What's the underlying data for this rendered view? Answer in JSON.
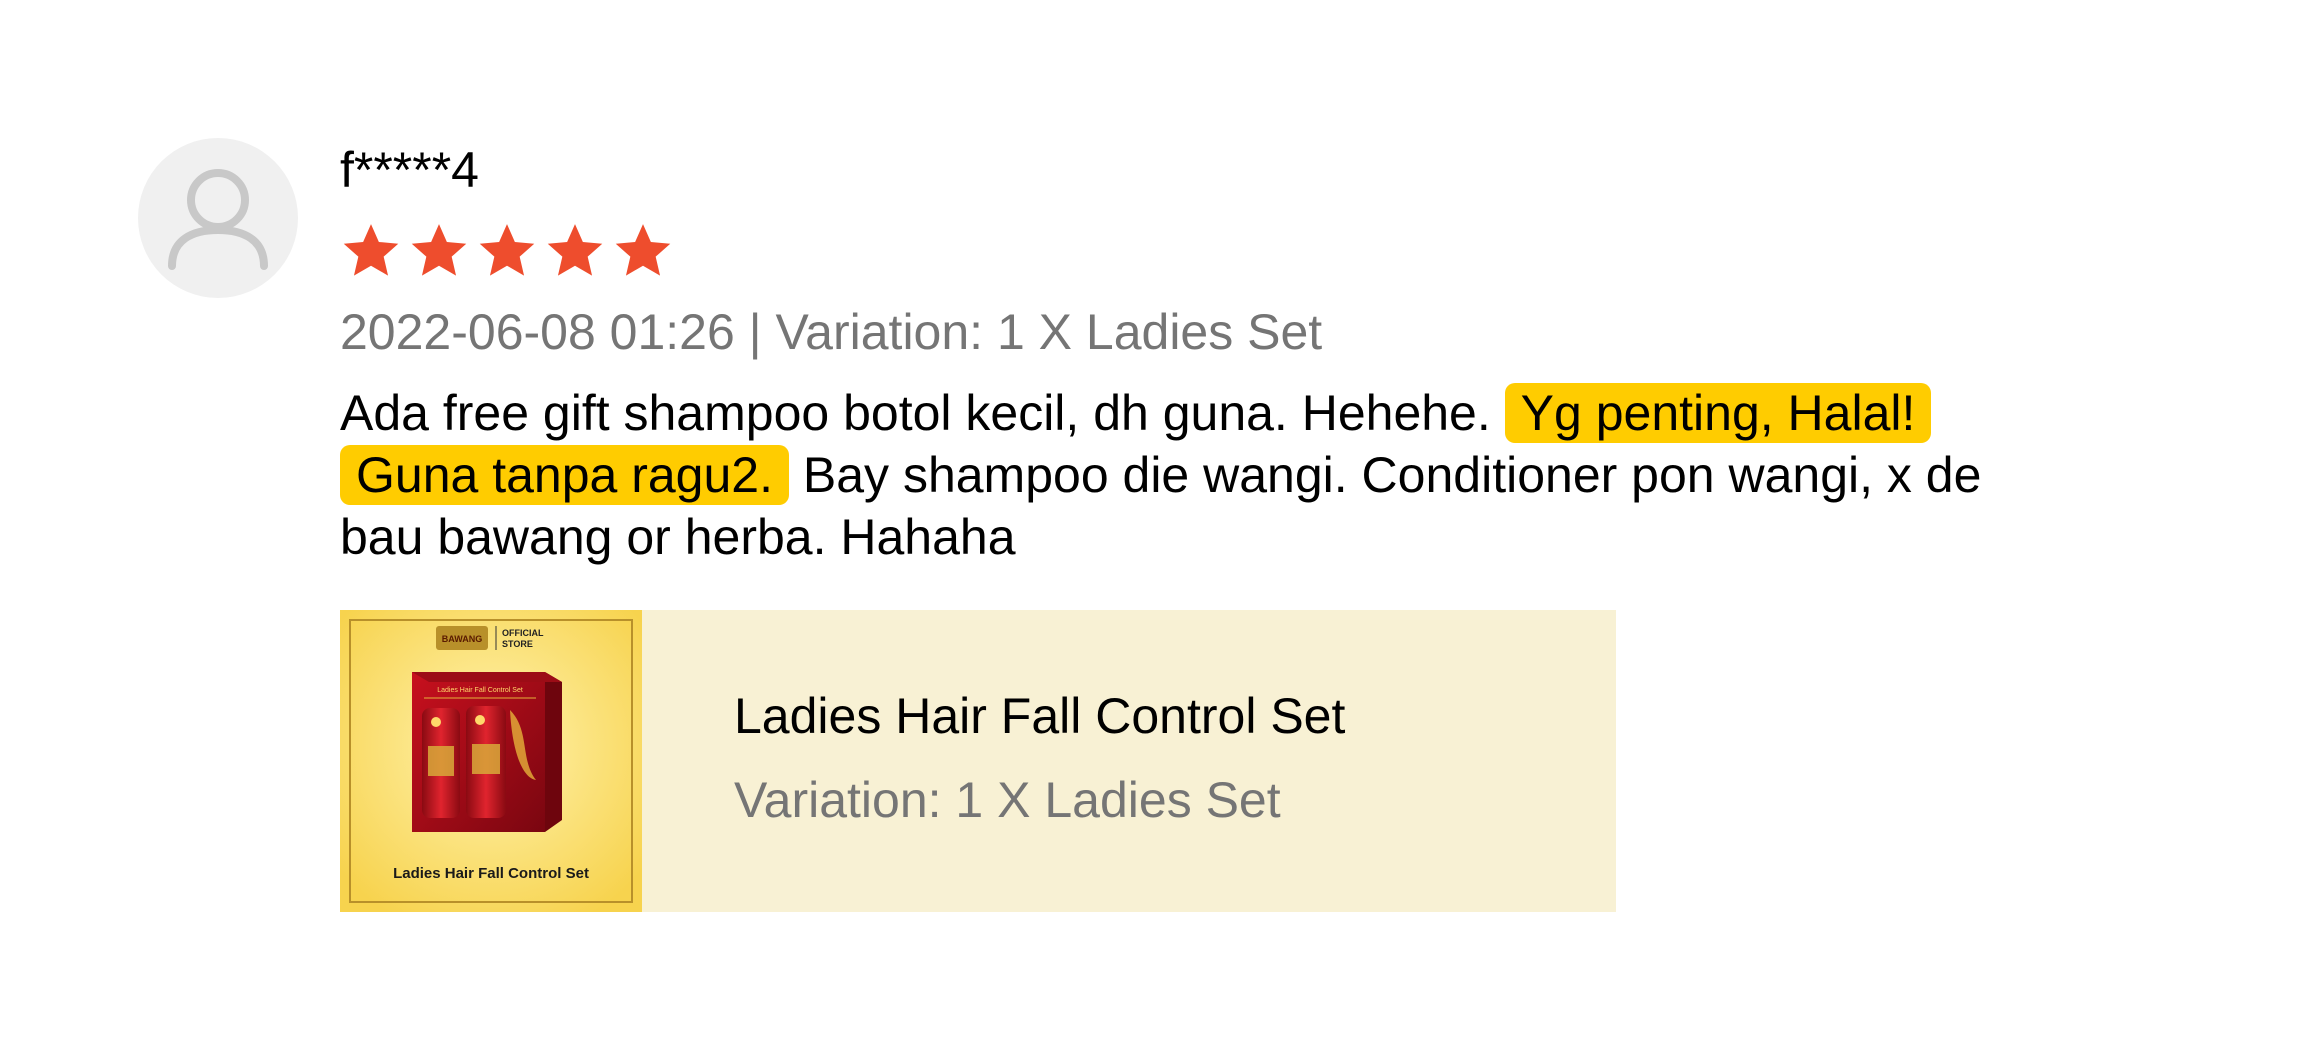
{
  "review": {
    "username": "f*****4",
    "rating": 5,
    "max_rating": 5,
    "star_color": "#ee4d2d",
    "meta": "2022-06-08 01:26 | Variation: 1 X Ladies Set",
    "comment": {
      "part1": "Ada free gift shampoo botol kecil, dh guna. Hehehe.",
      "highlight": "Yg penting, Halal! Guna tanpa ragu2.",
      "part2": " Bay shampoo die wangi. Conditioner pon wangi, x de bau bawang or herba. Hahaha",
      "highlight_color": "#ffcc00"
    }
  },
  "product": {
    "name": "Ladies Hair Fall Control Set",
    "variation": "Variation: 1 X Ladies Set",
    "background_color": "#f8f1d4",
    "thumbnail": {
      "brand": "BAWANG",
      "store_label_line1": "OFFICIAL",
      "store_label_line2": "STORE",
      "box_title": "Ladies Hair Fall Control Set",
      "caption": "Ladies Hair Fall Control Set"
    }
  }
}
